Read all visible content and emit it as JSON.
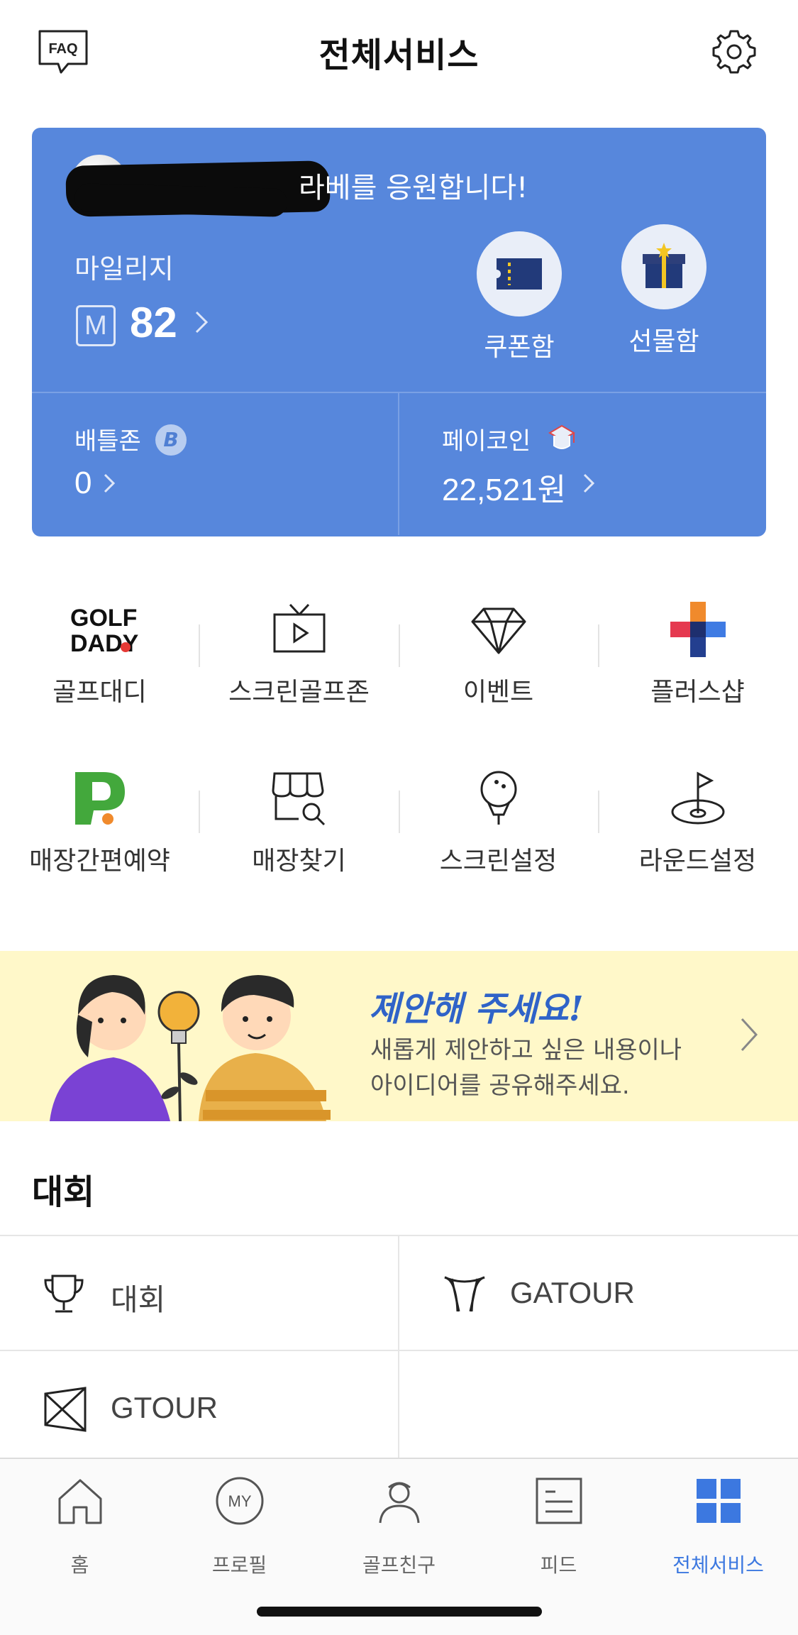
{
  "header": {
    "faq_label": "FAQ",
    "title": "전체서비스",
    "settings_icon": "gear-icon"
  },
  "card": {
    "cheer_text": "라베를 응원합니다!",
    "mileage_label": "마일리지",
    "mileage_badge": "M",
    "mileage_value": "82",
    "coupon_label": "쿠폰함",
    "gift_label": "선물함",
    "battle_label": "배틀존",
    "battle_badge": "B",
    "battle_value": "0",
    "pay_label": "페이코인",
    "pay_value": "22,521원",
    "colors": {
      "background": "#5787dc",
      "divider": "#7aa0e4"
    }
  },
  "services": [
    {
      "label": "골프대디",
      "icon": "golfdaddy-logo"
    },
    {
      "label": "스크린골프존",
      "icon": "tv-play-icon"
    },
    {
      "label": "이벤트",
      "icon": "diamond-icon"
    },
    {
      "label": "플러스샵",
      "icon": "plus-shop-icon"
    },
    {
      "label": "매장간편예약",
      "icon": "reservation-p-icon"
    },
    {
      "label": "매장찾기",
      "icon": "store-search-icon"
    },
    {
      "label": "스크린설정",
      "icon": "golf-ball-tee-icon"
    },
    {
      "label": "라운드설정",
      "icon": "flag-hole-icon"
    }
  ],
  "golfdaddy_logo": {
    "line1": "GOLF",
    "line2": "DADY"
  },
  "banner": {
    "title": "제안해 주세요!",
    "line1": "새롭게 제안하고 싶은 내용이나",
    "line2": "아이디어를 공유해주세요."
  },
  "competition": {
    "title": "대회",
    "items": [
      {
        "label": "대회",
        "icon": "trophy-icon"
      },
      {
        "label": "GATOUR",
        "icon": "gatour-icon"
      },
      {
        "label": "GTOUR",
        "icon": "gtour-icon"
      }
    ]
  },
  "bottom_nav": {
    "items": [
      {
        "label": "홈",
        "icon": "home-icon",
        "active": false
      },
      {
        "label": "프로필",
        "icon": "my-profile-icon",
        "active": false
      },
      {
        "label": "골프친구",
        "icon": "golf-friend-icon",
        "active": false
      },
      {
        "label": "피드",
        "icon": "feed-icon",
        "active": false
      },
      {
        "label": "전체서비스",
        "icon": "grid-icon",
        "active": true
      }
    ],
    "my_text": "MY",
    "active_color": "#3c78e0"
  }
}
